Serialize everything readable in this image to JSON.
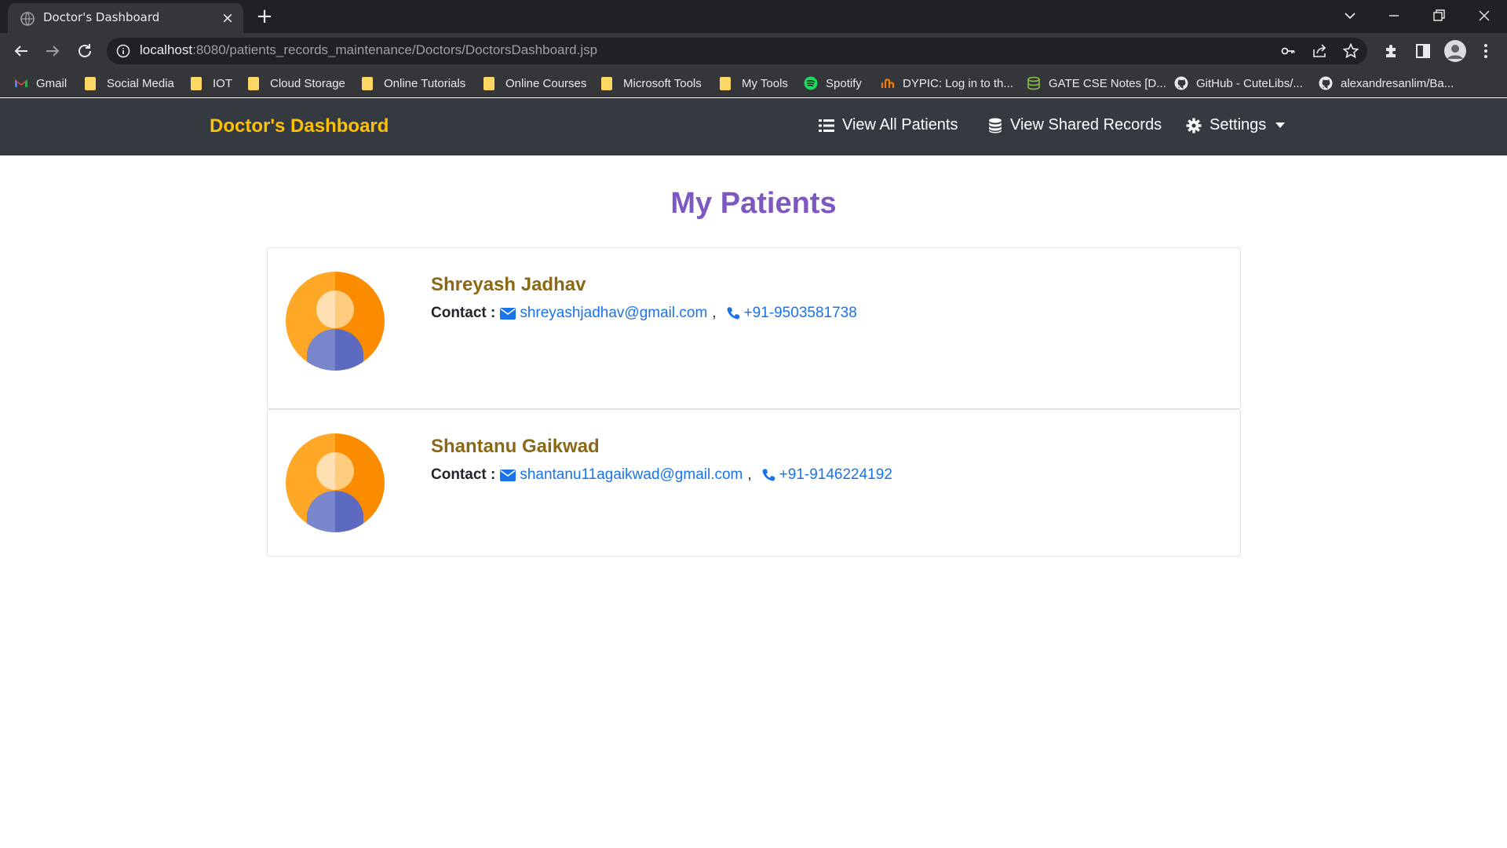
{
  "browser": {
    "tab_title": "Doctor's Dashboard",
    "url_host": "localhost",
    "url_path": ":8080/patients_records_maintenance/Doctors/DoctorsDashboard.jsp",
    "bookmarks": [
      {
        "label": "Gmail",
        "icon": "gmail-icon"
      },
      {
        "label": "Social Media",
        "icon": "folder-icon"
      },
      {
        "label": "IOT",
        "icon": "folder-icon"
      },
      {
        "label": "Cloud Storage",
        "icon": "folder-icon"
      },
      {
        "label": "Online Tutorials",
        "icon": "folder-icon"
      },
      {
        "label": "Online Courses",
        "icon": "folder-icon"
      },
      {
        "label": "Microsoft Tools",
        "icon": "folder-icon"
      },
      {
        "label": "My Tools",
        "icon": "folder-icon"
      },
      {
        "label": "Spotify",
        "icon": "spotify-icon"
      },
      {
        "label": "DYPIC: Log in to th...",
        "icon": "dypic-icon"
      },
      {
        "label": "GATE CSE Notes [D...",
        "icon": "stack-icon"
      },
      {
        "label": "GitHub - CuteLibs/...",
        "icon": "github-icon"
      },
      {
        "label": "alexandresanlim/Ba...",
        "icon": "github-icon"
      }
    ]
  },
  "navbar": {
    "brand": "Doctor's Dashboard",
    "links": [
      {
        "label": "View All Patients",
        "icon": "list-icon"
      },
      {
        "label": "View Shared Records",
        "icon": "database-icon"
      },
      {
        "label": "Settings",
        "icon": "gear-icon"
      }
    ]
  },
  "page": {
    "title": "My Patients",
    "contact_label": "Contact :",
    "separator": ","
  },
  "patients": [
    {
      "name": "Shreyash Jadhav",
      "email": "shreyashjadhav@gmail.com",
      "phone": "+91-9503581738"
    },
    {
      "name": "Shantanu Gaikwad",
      "email": "shantanu11agaikwad@gmail.com",
      "phone": "+91-9146224192"
    }
  ],
  "colors": {
    "brand": "#ffc107",
    "title": "#7e57c2",
    "patient_name": "#8b6914",
    "link": "#1a73e8",
    "navbar_bg": "#343a40"
  }
}
